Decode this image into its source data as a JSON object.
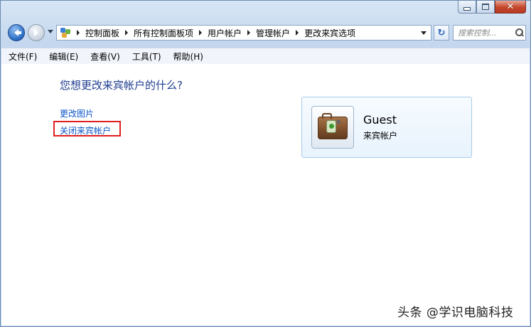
{
  "window": {
    "min_label": "",
    "max_label": "",
    "close_label": "✕"
  },
  "nav": {
    "breadcrumbs": [
      "控制面板",
      "所有控制面板项",
      "用户帐户",
      "管理帐户",
      "更改来宾选项"
    ],
    "search_placeholder": "搜索控制...",
    "refresh_glyph": "↻"
  },
  "menu": {
    "items": [
      "文件(F)",
      "编辑(E)",
      "查看(V)",
      "工具(T)",
      "帮助(H)"
    ]
  },
  "main": {
    "heading": "您想更改来宾帐户的什么?",
    "links": [
      "更改图片",
      "关闭来宾帐户"
    ],
    "highlighted_link_color": "#e02020"
  },
  "account": {
    "name": "Guest",
    "type": "来宾帐户"
  },
  "watermark": "头条 @学识电脑科技"
}
